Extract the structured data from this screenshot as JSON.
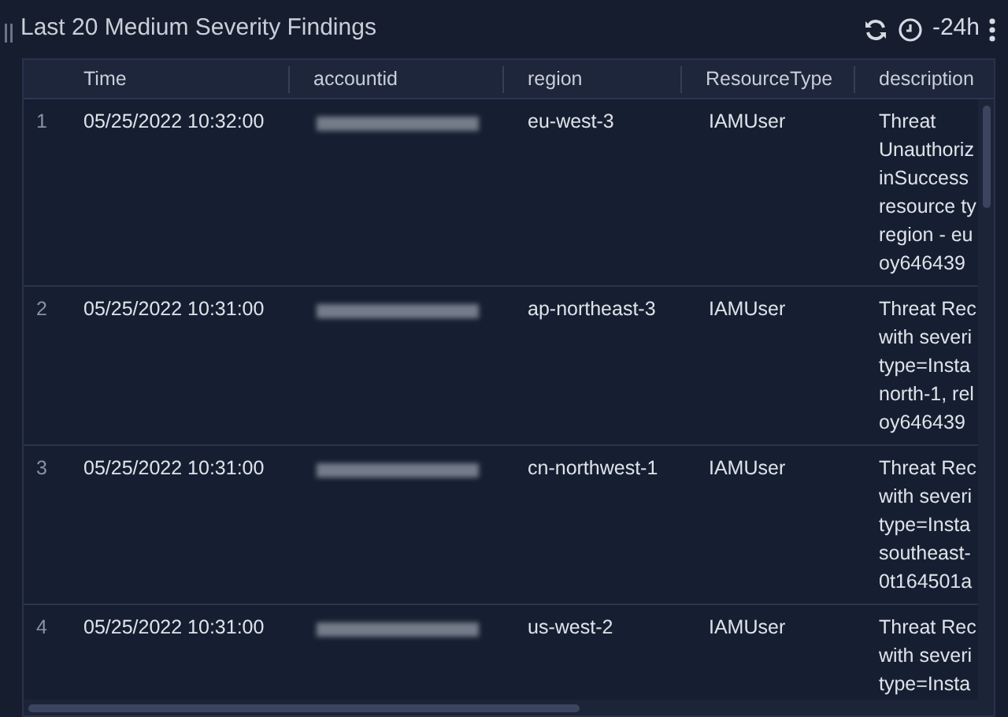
{
  "panel": {
    "title": "Last 20 Medium Severity Findings",
    "time_range": "-24h"
  },
  "table": {
    "columns": [
      "Time",
      "accountid",
      "region",
      "ResourceType",
      "description"
    ],
    "rows": [
      {
        "index": "1",
        "time": "05/25/2022 10:32:00",
        "region": "eu-west-3",
        "resource_type": "IAMUser",
        "description": [
          "Threat",
          "Unauthoriz",
          "inSuccess",
          "resource ty",
          "region - eu",
          "oy646439"
        ]
      },
      {
        "index": "2",
        "time": "05/25/2022 10:31:00",
        "region": "ap-northeast-3",
        "resource_type": "IAMUser",
        "description": [
          "Threat Rec",
          "with severi",
          "type=Insta",
          "north-1, rel",
          "oy646439"
        ]
      },
      {
        "index": "3",
        "time": "05/25/2022 10:31:00",
        "region": "cn-northwest-1",
        "resource_type": "IAMUser",
        "description": [
          "Threat Rec",
          "with severi",
          "type=Insta",
          "southeast-",
          "0t164501a"
        ]
      },
      {
        "index": "4",
        "time": "05/25/2022 10:31:00",
        "region": "us-west-2",
        "resource_type": "IAMUser",
        "description": [
          "Threat Rec",
          "with severi",
          "type=Insta"
        ]
      }
    ]
  }
}
